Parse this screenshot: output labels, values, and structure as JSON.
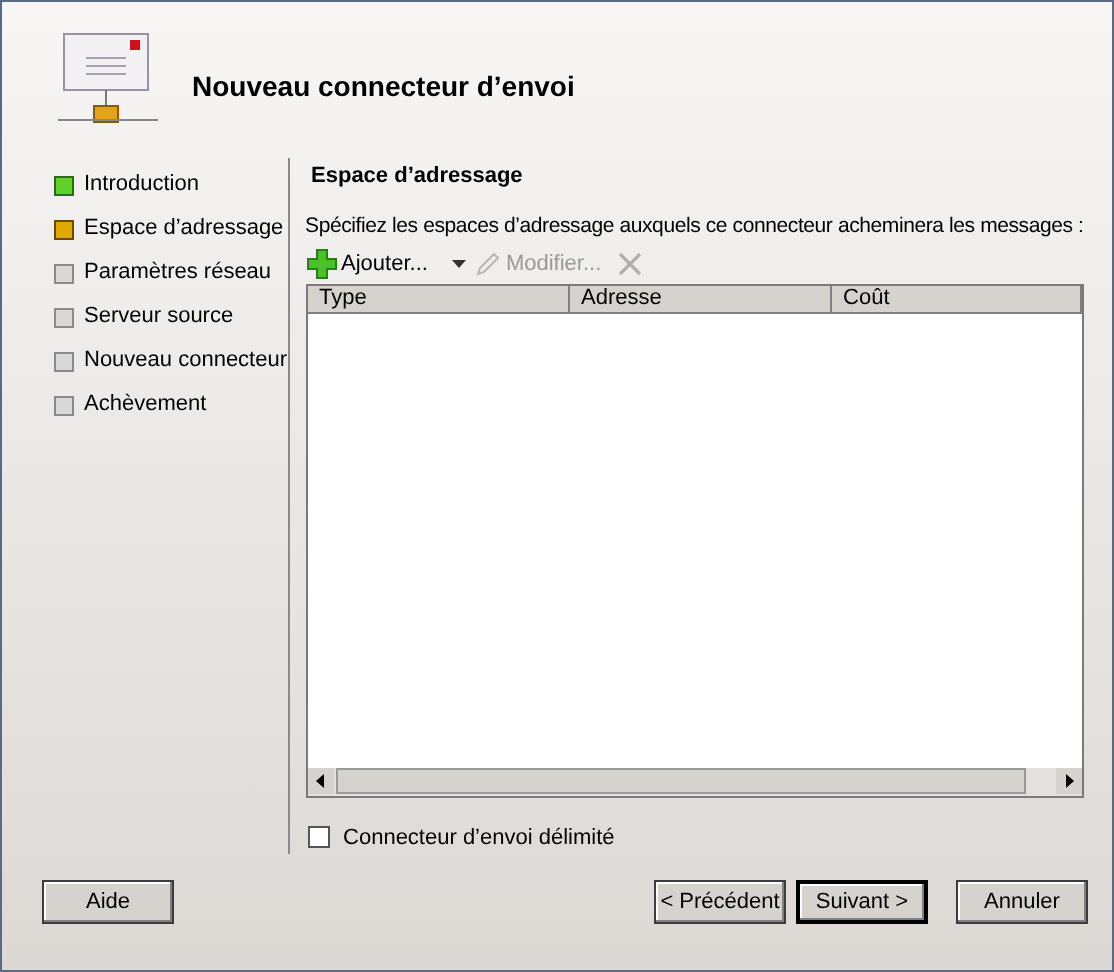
{
  "window": {
    "title": "Nouveau connecteur d’envoi"
  },
  "steps": [
    {
      "label": "Introduction",
      "kind": "done"
    },
    {
      "label": "Espace d’adressage",
      "kind": "current"
    },
    {
      "label": "Paramètres réseau",
      "kind": "pending"
    },
    {
      "label": "Serveur source",
      "kind": "pending"
    },
    {
      "label": "Nouveau connecteur",
      "kind": "pending"
    },
    {
      "label": "Achèvement",
      "kind": "pending"
    }
  ],
  "section": {
    "heading": "Espace d’adressage",
    "instruction": "Spécifiez les espaces d’adressage auxquels ce connecteur acheminera les messages :"
  },
  "toolbar": [
    {
      "kind": "add",
      "label": "Ajouter...",
      "disabled": false
    },
    {
      "kind": "edit",
      "label": "Modifier...",
      "disabled": true
    },
    {
      "kind": "delete",
      "disabled": true
    }
  ],
  "table": {
    "columns": [
      "Type",
      "Adresse",
      "Coût"
    ]
  },
  "scoped_checkbox": {
    "label": "Connecteur d’envoi délimité",
    "checked": false
  },
  "buttons": {
    "help": "Aide",
    "back": "< Précédent",
    "next": "Suivant >",
    "cancel": "Annuler"
  }
}
